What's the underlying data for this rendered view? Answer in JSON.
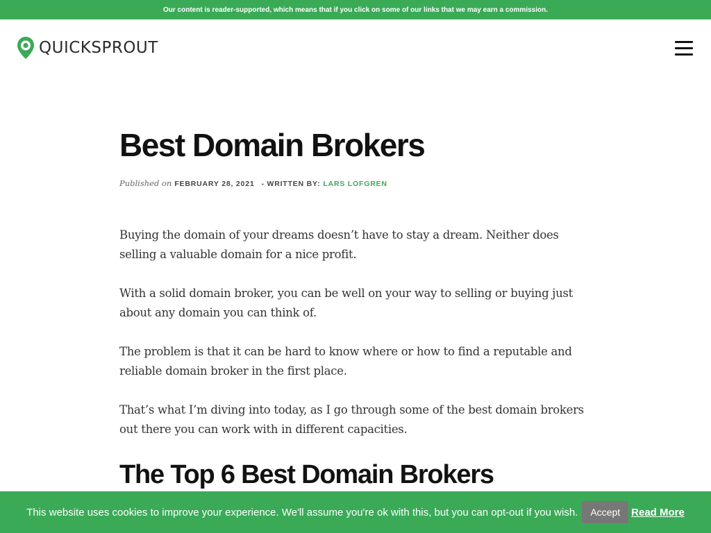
{
  "topbar": {
    "notice": "Our content is reader-supported, which means that if you click on some of our links that we may earn a commission."
  },
  "header": {
    "logo_text": "QUICKSPROUT",
    "logo_icon": "quicksprout-logo-icon",
    "menu_icon": "hamburger-menu-icon"
  },
  "article": {
    "title": "Best Domain Brokers",
    "published_label": "Published on",
    "date": "FEBRUARY 28, 2021",
    "written_by": "- WRITTEN BY:",
    "author": "LARS LOFGREN",
    "paragraphs": [
      "Buying the domain of your dreams doesn’t have to stay a dream. Neither does selling a valuable domain for a nice profit.",
      "With a solid domain broker, you can be well on your way to selling or buying just about any domain you can think of.",
      "The problem is that it can be hard to know where or how to find a reputable and reliable domain broker in the first place.",
      "That’s what I’m diving into today, as I go through some of the best domain brokers out there you can work with in different capacities."
    ],
    "subheading": "The Top 6 Best Domain Brokers"
  },
  "cookie": {
    "message": "This website uses cookies to improve your experience. We'll assume you're ok with this, but you can opt-out if you wish.",
    "accept_label": "Accept",
    "read_more_label": "Read More"
  },
  "colors": {
    "brand_green": "#3aaa57",
    "accept_gray": "#777777"
  }
}
